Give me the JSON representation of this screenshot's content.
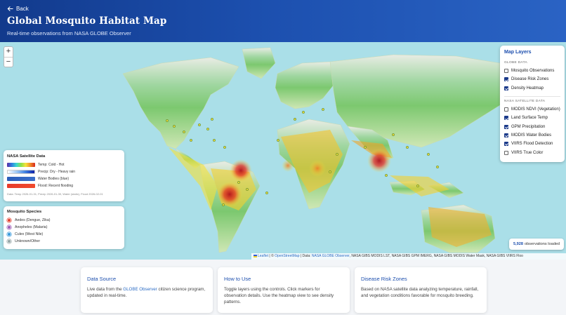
{
  "header": {
    "back_label": "Back",
    "title": "Global Mosquito Habitat Map",
    "subtitle": "Real-time observations from NASA GLOBE Observer"
  },
  "zoom": {
    "in_label": "+",
    "out_label": "−"
  },
  "layers": {
    "title": "Map Layers",
    "globe_heading": "GLOBE DATA",
    "globe_items": [
      {
        "label": "Mosquito Observations",
        "checked": false
      },
      {
        "label": "Disease Risk Zones",
        "checked": true
      },
      {
        "label": "Density Heatmap",
        "checked": true
      }
    ],
    "nasa_heading": "NASA SATELLITE DATA",
    "nasa_items": [
      {
        "label": "MODIS NDVI (Vegetation)",
        "checked": false
      },
      {
        "label": "Land Surface Temp",
        "checked": true
      },
      {
        "label": "GPM Precipitation",
        "checked": true
      },
      {
        "label": "MODIS Water Bodies",
        "checked": true
      },
      {
        "label": "VIIRS Flood Detection",
        "checked": true
      },
      {
        "label": "VIIRS True Color",
        "checked": false
      }
    ]
  },
  "sat_legend": {
    "title": "NASA Satellite Data",
    "rows": [
      {
        "label": "Temp: Cold - Hot",
        "colors": [
          "#5a2ea6",
          "#2f7de0",
          "#37d6d0",
          "#8de04a",
          "#f6e23a",
          "#f08a28",
          "#d7261e"
        ]
      },
      {
        "label": "Precip: Dry - Heavy rain",
        "colors": [
          "#ffffff",
          "#9ec9f4",
          "#3d7fe0",
          "#0a1ea8"
        ]
      },
      {
        "label": "Water Bodies (blue)",
        "colors": [
          "#2a5db8",
          "#3a6fca"
        ]
      },
      {
        "label": "Flood: Recent flooding",
        "colors": [
          "#e83b2a",
          "#f04a2e"
        ]
      }
    ],
    "note": "Data: Temp 2026-01-31, Precip 2026-01-30, Water (static), Flood 2026-02-01"
  },
  "species_legend": {
    "title": "Mosquito Species",
    "items": [
      {
        "label": "Aedes (Dengue, Zika)",
        "color": "#e2402f"
      },
      {
        "label": "Anopheles (Malaria)",
        "color": "#9b59b6"
      },
      {
        "label": "Culex (West Nile)",
        "color": "#3498db"
      },
      {
        "label": "Unknown/Other",
        "color": "#95a5a6"
      }
    ]
  },
  "observations": {
    "count": "5,928",
    "suffix": "observations loaded"
  },
  "attribution": {
    "leaflet": "Leaflet",
    "sep1": " | © ",
    "osm": "OpenStreetMap",
    "sep2": " | Data: ",
    "globe": "NASA GLOBE Observer",
    "rest": ", NASA GIBS MODIS LST, NASA GIBS GPM IMERG, NASA GIBS MODIS Water Mask, NASA GIBS VIIRS Floo"
  },
  "cards": [
    {
      "title": "Data Source",
      "text_before": "Live data from the ",
      "link": "GLOBE Observer",
      "text_after": " citizen science program, updated in real-time."
    },
    {
      "title": "How to Use",
      "text_before": "Toggle layers using the controls. Click markers for observation details. Use the heatmap view to see density patterns.",
      "link": "",
      "text_after": ""
    },
    {
      "title": "Disease Risk Zones",
      "text_before": "Based on NASA satellite data analyzing temperature, rainfall, and vegetation conditions favorable for mosquito breeding.",
      "link": "",
      "text_after": ""
    }
  ]
}
